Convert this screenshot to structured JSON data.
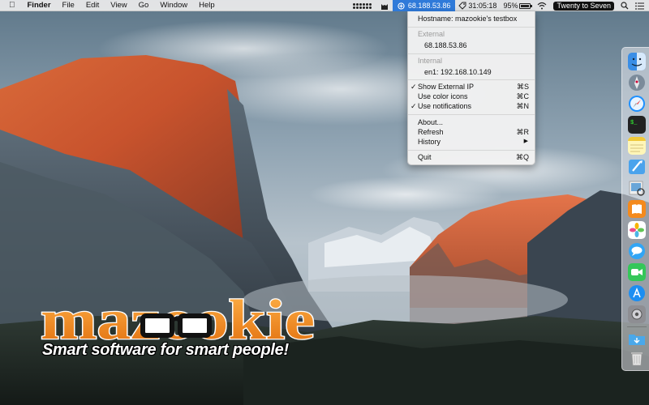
{
  "menubar": {
    "app_name": "Finder",
    "menus": [
      "File",
      "Edit",
      "View",
      "Go",
      "Window",
      "Help"
    ],
    "status": {
      "ip_address": "68.188.53.86",
      "timer": "31:05:18",
      "battery": "95%",
      "clock": "Twenty to Seven"
    }
  },
  "dropdown": {
    "hostname": "Hostname: mazookie's testbox",
    "external_header": "External",
    "external_ip": "68.188.53.86",
    "internal_header": "Internal",
    "internal_ip": "en1: 192.168.10.149",
    "options": [
      {
        "label": "Show External IP",
        "checked": true,
        "shortcut": "⌘S"
      },
      {
        "label": "Use color icons",
        "checked": false,
        "shortcut": "⌘C"
      },
      {
        "label": "Use notifications",
        "checked": true,
        "shortcut": "⌘N"
      }
    ],
    "actions": [
      {
        "label": "About...",
        "shortcut": ""
      },
      {
        "label": "Refresh",
        "shortcut": "⌘R"
      },
      {
        "label": "History",
        "shortcut": "",
        "submenu": true
      }
    ],
    "quit": {
      "label": "Quit",
      "shortcut": "⌘Q"
    }
  },
  "dock": {
    "icons": [
      "finder-icon",
      "launchpad-icon",
      "safari-icon",
      "terminal-icon",
      "notes-icon",
      "xcode-icon",
      "preview-icon",
      "ibooks-icon",
      "photos-icon",
      "messages-icon",
      "facetime-icon",
      "app-store-icon",
      "system-preferences-icon",
      "downloads-folder-icon",
      "trash-icon"
    ]
  },
  "logo": {
    "word": "mazookie",
    "tagline": "Smart software for smart people!"
  },
  "colors": {
    "menu_highlight": "#2f7ad9",
    "logo_orange": "#f28a1a"
  }
}
